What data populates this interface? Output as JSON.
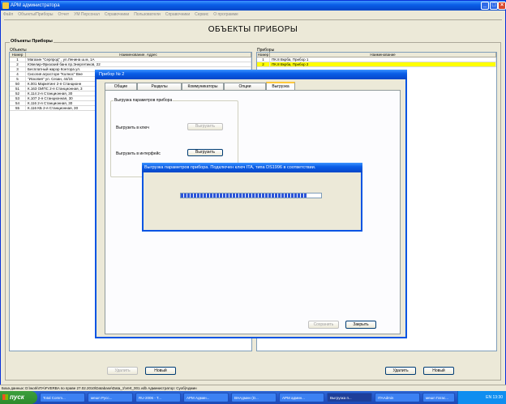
{
  "window": {
    "title": "АРМ администратора"
  },
  "menu": [
    "Файл",
    "Объекты/Приборы",
    "Отчет",
    "УМ Персонал",
    "Справочники",
    "Пользователи",
    "Справочники",
    "Сервис",
    "О программе"
  ],
  "page_title": "ОБЪЕКТЫ   ПРИБОРЫ",
  "objects": {
    "group_title": "Объекты   Приборы",
    "panel_title": "Объекты",
    "columns": [
      "Номер",
      "Наименование. Адрес"
    ],
    "rows": [
      [
        "1",
        "Магазин \"Серпрод\" , ул.Ленина ш.м, 1А"
      ],
      [
        "2",
        "Ювелир-Фризский банк  пр.Энергетиков, 22"
      ],
      [
        "3",
        "Бесплатный жарэр Контора  ул."
      ],
      [
        "4",
        "Сисогия агросторе \"Колнос\"  Вне"
      ],
      [
        "5",
        "\"Ископия\"  ул. Сезан, 44/15"
      ],
      [
        "50",
        "К.001 Маркетинг  2-я Станционн"
      ],
      [
        "51",
        "К.163 ОИПС  2-я Станционная, 3"
      ],
      [
        "52",
        "К.114  2-я Станционная, 30"
      ],
      [
        "53",
        "К.107  2-я Станционная, 30"
      ],
      [
        "54",
        "К.116  2-я Станционная, 30"
      ],
      [
        "55",
        "К.116 КБ  2-я Станционная, 30"
      ]
    ],
    "btn_delete": "Удалить",
    "btn_new": "Новый"
  },
  "devices": {
    "panel_title": "Приборы",
    "columns": [
      "Номер",
      "Наименование"
    ],
    "rows": [
      [
        "1",
        "ПК.8 Вкрба, Прибор 1"
      ],
      [
        "2",
        "ПК.8 Вкрба, Прибор 2"
      ]
    ],
    "btn_delete": "Удалить",
    "btn_new": "Новый"
  },
  "dialog": {
    "title": "Прибор № 2",
    "tabs": [
      "Общие",
      "Разделы",
      "Коммуникаторы",
      "Опции",
      "Выгрузка"
    ],
    "group_label": "Выгрузка параметров прибора",
    "row1_label": "Выгрузить в ключ",
    "row1_btn": "Выгрузить",
    "row2_label": "Выгрузить в интерфейс",
    "row2_btn": "Выгрузить",
    "btn_save": "Сохранить",
    "btn_close": "Закрыть"
  },
  "progress": {
    "title": "Выгрузка параметров прибора. Подключен ключ ITA, типа DS1996 в соответствии.",
    "fraction": 0.9
  },
  "status": "База данных: D:\\work\\ITA\\FVERBA по праве 27.02.2010\\Database\\Data_1\\Vert_001.vdb  Администратор: Суоб|Админ",
  "taskbar": {
    "start": "пуск",
    "tasks": [
      "Total Comm...",
      "мешп Русс...",
      "RU-2006 - Т...",
      "АРМ Админ...",
      "ВНАдмин (D...",
      "АРМ админ...",
      "Выгрузка п...",
      "ITAAdmin",
      "мешп Гатас..."
    ],
    "tray_text": "EN  13:30"
  }
}
